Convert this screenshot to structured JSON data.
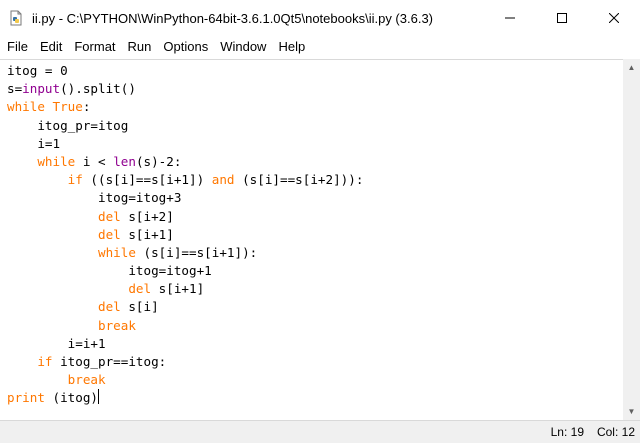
{
  "window": {
    "title": "ii.py - C:\\PYTHON\\WinPython-64bit-3.6.1.0Qt5\\notebooks\\ii.py (3.6.3)",
    "app_icon": "python-file-icon",
    "controls": {
      "minimize_icon": "minimize-icon",
      "maximize_icon": "maximize-icon",
      "close_icon": "close-icon"
    }
  },
  "menu": {
    "items": [
      "File",
      "Edit",
      "Format",
      "Run",
      "Options",
      "Window",
      "Help"
    ]
  },
  "editor": {
    "colors": {
      "keyword": "#ff7700",
      "builtin": "#900090",
      "text": "#000000"
    },
    "lines": [
      {
        "indent": "",
        "tokens": [
          {
            "t": "itog = 0"
          }
        ]
      },
      {
        "indent": "",
        "tokens": [
          {
            "t": "s="
          },
          {
            "t": "input",
            "k": "bi"
          },
          {
            "t": "().split()"
          }
        ]
      },
      {
        "indent": "",
        "tokens": [
          {
            "t": "while",
            "k": "kw"
          },
          {
            "t": " "
          },
          {
            "t": "True",
            "k": "kw"
          },
          {
            "t": ":"
          }
        ]
      },
      {
        "indent": "    ",
        "tokens": [
          {
            "t": "itog_pr=itog"
          }
        ]
      },
      {
        "indent": "    ",
        "tokens": [
          {
            "t": "i=1"
          }
        ]
      },
      {
        "indent": "    ",
        "tokens": [
          {
            "t": "while",
            "k": "kw"
          },
          {
            "t": " i < "
          },
          {
            "t": "len",
            "k": "bi"
          },
          {
            "t": "(s)-2:"
          }
        ]
      },
      {
        "indent": "        ",
        "tokens": [
          {
            "t": "if",
            "k": "kw"
          },
          {
            "t": " ((s[i]==s[i+1]) "
          },
          {
            "t": "and",
            "k": "kw"
          },
          {
            "t": " (s[i]==s[i+2])):"
          }
        ]
      },
      {
        "indent": "            ",
        "tokens": [
          {
            "t": "itog=itog+3"
          }
        ]
      },
      {
        "indent": "            ",
        "tokens": [
          {
            "t": "del",
            "k": "kw"
          },
          {
            "t": " s[i+2]"
          }
        ]
      },
      {
        "indent": "            ",
        "tokens": [
          {
            "t": "del",
            "k": "kw"
          },
          {
            "t": " s[i+1]"
          }
        ]
      },
      {
        "indent": "            ",
        "tokens": [
          {
            "t": "while",
            "k": "kw"
          },
          {
            "t": " (s[i]==s[i+1]):"
          }
        ]
      },
      {
        "indent": "                ",
        "tokens": [
          {
            "t": "itog=itog+1"
          }
        ]
      },
      {
        "indent": "                ",
        "tokens": [
          {
            "t": "del",
            "k": "kw"
          },
          {
            "t": " s[i+1]"
          }
        ]
      },
      {
        "indent": "            ",
        "tokens": [
          {
            "t": "del",
            "k": "kw"
          },
          {
            "t": " s[i]"
          }
        ]
      },
      {
        "indent": "            ",
        "tokens": [
          {
            "t": "break",
            "k": "kw"
          }
        ]
      },
      {
        "indent": "        ",
        "tokens": [
          {
            "t": "i=i+1"
          }
        ]
      },
      {
        "indent": "    ",
        "tokens": [
          {
            "t": "if",
            "k": "kw"
          },
          {
            "t": " itog_pr==itog:"
          }
        ]
      },
      {
        "indent": "        ",
        "tokens": [
          {
            "t": "break",
            "k": "kw"
          }
        ]
      },
      {
        "indent": "",
        "tokens": [
          {
            "t": "print",
            "k": "kw"
          },
          {
            "t": " (itog)"
          }
        ],
        "caret": true
      }
    ]
  },
  "status": {
    "ln": "Ln: 19",
    "col": "Col: 12"
  }
}
